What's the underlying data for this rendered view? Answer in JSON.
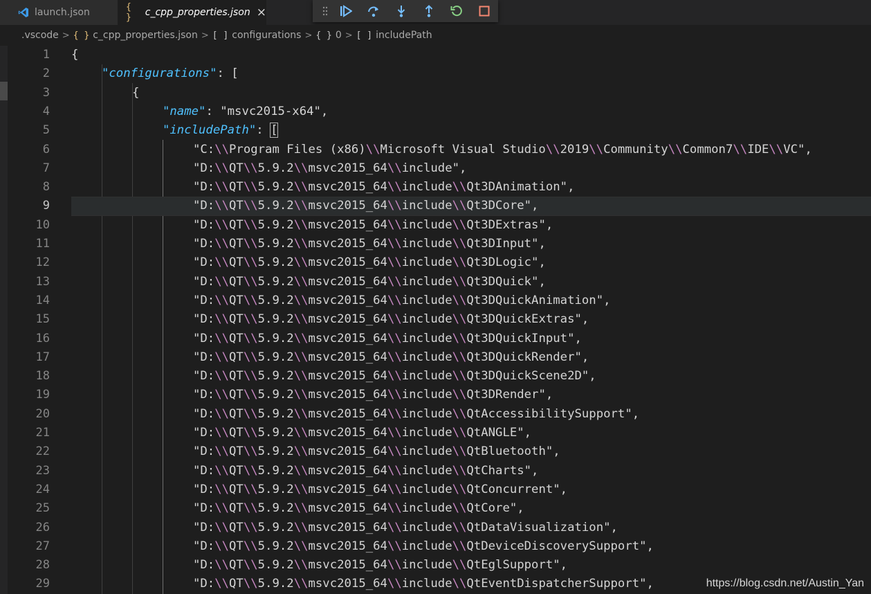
{
  "tabs": [
    {
      "label": "launch.json",
      "icon": "vscode-icon",
      "active": false
    },
    {
      "label": "c_cpp_properties.json",
      "icon": "braces-icon",
      "active": true,
      "close": "×"
    }
  ],
  "tab_icons": {
    "braces": "{ }"
  },
  "debug_toolbar": {
    "buttons": [
      "drag-grip",
      "continue",
      "step-over",
      "step-into",
      "step-out",
      "restart",
      "stop"
    ],
    "colors": {
      "blue": "#75beff",
      "green": "#89d185",
      "red": "#f48771",
      "grip": "#8c8c8c"
    }
  },
  "breadcrumb": [
    {
      "label": ".vscode",
      "icon": ""
    },
    {
      "label": "c_cpp_properties.json",
      "icon": "{ }"
    },
    {
      "label": "configurations",
      "icon": "[ ]"
    },
    {
      "label": "0",
      "icon": "{ }"
    },
    {
      "label": "includePath",
      "icon": "[ ]"
    }
  ],
  "editor": {
    "current_line": 9,
    "lines": [
      {
        "n": "1",
        "tokens": [
          {
            "t": "{",
            "c": "#d4d4d4"
          }
        ]
      },
      {
        "n": "2",
        "tokens": [
          {
            "t": "\"configurations\"",
            "c": "k"
          },
          {
            "t": ": [",
            "c": "#d4d4d4"
          }
        ]
      },
      {
        "n": "3",
        "tokens": [
          {
            "t": "{",
            "c": "#d4d4d4"
          }
        ]
      },
      {
        "n": "4",
        "tokens": [
          {
            "t": "\"name\"",
            "c": "k"
          },
          {
            "t": ": \"msvc2015-x64\",",
            "c": "#d4d4d4"
          }
        ]
      },
      {
        "n": "5",
        "tokens": [
          {
            "t": "\"includePath\"",
            "c": "k"
          },
          {
            "t": ": ",
            "c": "#d4d4d4"
          },
          {
            "t": "[",
            "c": "box"
          }
        ]
      },
      {
        "n": "6",
        "path": "\"C:\\\\Program Files (x86)\\\\Microsoft Visual Studio\\\\2019\\\\Community\\\\Common7\\\\IDE\\\\VC\","
      },
      {
        "n": "7",
        "path": "\"D:\\\\QT\\\\5.9.2\\\\msvc2015_64\\\\include\","
      },
      {
        "n": "8",
        "path": "\"D:\\\\QT\\\\5.9.2\\\\msvc2015_64\\\\include\\\\Qt3DAnimation\","
      },
      {
        "n": "9",
        "path": "\"D:\\\\QT\\\\5.9.2\\\\msvc2015_64\\\\include\\\\Qt3DCore\","
      },
      {
        "n": "10",
        "path": "\"D:\\\\QT\\\\5.9.2\\\\msvc2015_64\\\\include\\\\Qt3DExtras\","
      },
      {
        "n": "11",
        "path": "\"D:\\\\QT\\\\5.9.2\\\\msvc2015_64\\\\include\\\\Qt3DInput\","
      },
      {
        "n": "12",
        "path": "\"D:\\\\QT\\\\5.9.2\\\\msvc2015_64\\\\include\\\\Qt3DLogic\","
      },
      {
        "n": "13",
        "path": "\"D:\\\\QT\\\\5.9.2\\\\msvc2015_64\\\\include\\\\Qt3DQuick\","
      },
      {
        "n": "14",
        "path": "\"D:\\\\QT\\\\5.9.2\\\\msvc2015_64\\\\include\\\\Qt3DQuickAnimation\","
      },
      {
        "n": "15",
        "path": "\"D:\\\\QT\\\\5.9.2\\\\msvc2015_64\\\\include\\\\Qt3DQuickExtras\","
      },
      {
        "n": "16",
        "path": "\"D:\\\\QT\\\\5.9.2\\\\msvc2015_64\\\\include\\\\Qt3DQuickInput\","
      },
      {
        "n": "17",
        "path": "\"D:\\\\QT\\\\5.9.2\\\\msvc2015_64\\\\include\\\\Qt3DQuickRender\","
      },
      {
        "n": "18",
        "path": "\"D:\\\\QT\\\\5.9.2\\\\msvc2015_64\\\\include\\\\Qt3DQuickScene2D\","
      },
      {
        "n": "19",
        "path": "\"D:\\\\QT\\\\5.9.2\\\\msvc2015_64\\\\include\\\\Qt3DRender\","
      },
      {
        "n": "20",
        "path": "\"D:\\\\QT\\\\5.9.2\\\\msvc2015_64\\\\include\\\\QtAccessibilitySupport\","
      },
      {
        "n": "21",
        "path": "\"D:\\\\QT\\\\5.9.2\\\\msvc2015_64\\\\include\\\\QtANGLE\","
      },
      {
        "n": "22",
        "path": "\"D:\\\\QT\\\\5.9.2\\\\msvc2015_64\\\\include\\\\QtBluetooth\","
      },
      {
        "n": "23",
        "path": "\"D:\\\\QT\\\\5.9.2\\\\msvc2015_64\\\\include\\\\QtCharts\","
      },
      {
        "n": "24",
        "path": "\"D:\\\\QT\\\\5.9.2\\\\msvc2015_64\\\\include\\\\QtConcurrent\","
      },
      {
        "n": "25",
        "path": "\"D:\\\\QT\\\\5.9.2\\\\msvc2015_64\\\\include\\\\QtCore\","
      },
      {
        "n": "26",
        "path": "\"D:\\\\QT\\\\5.9.2\\\\msvc2015_64\\\\include\\\\QtDataVisualization\","
      },
      {
        "n": "27",
        "path": "\"D:\\\\QT\\\\5.9.2\\\\msvc2015_64\\\\include\\\\QtDeviceDiscoverySupport\","
      },
      {
        "n": "28",
        "path": "\"D:\\\\QT\\\\5.9.2\\\\msvc2015_64\\\\include\\\\QtEglSupport\","
      },
      {
        "n": "29",
        "path": "\"D:\\\\QT\\\\5.9.2\\\\msvc2015_64\\\\include\\\\QtEventDispatcherSupport\","
      }
    ],
    "colors": {
      "key": "#4fc1ff",
      "text": "#d4d4d4",
      "escape": "#c586c0"
    }
  },
  "watermark": "https://blog.csdn.net/Austin_Yan"
}
